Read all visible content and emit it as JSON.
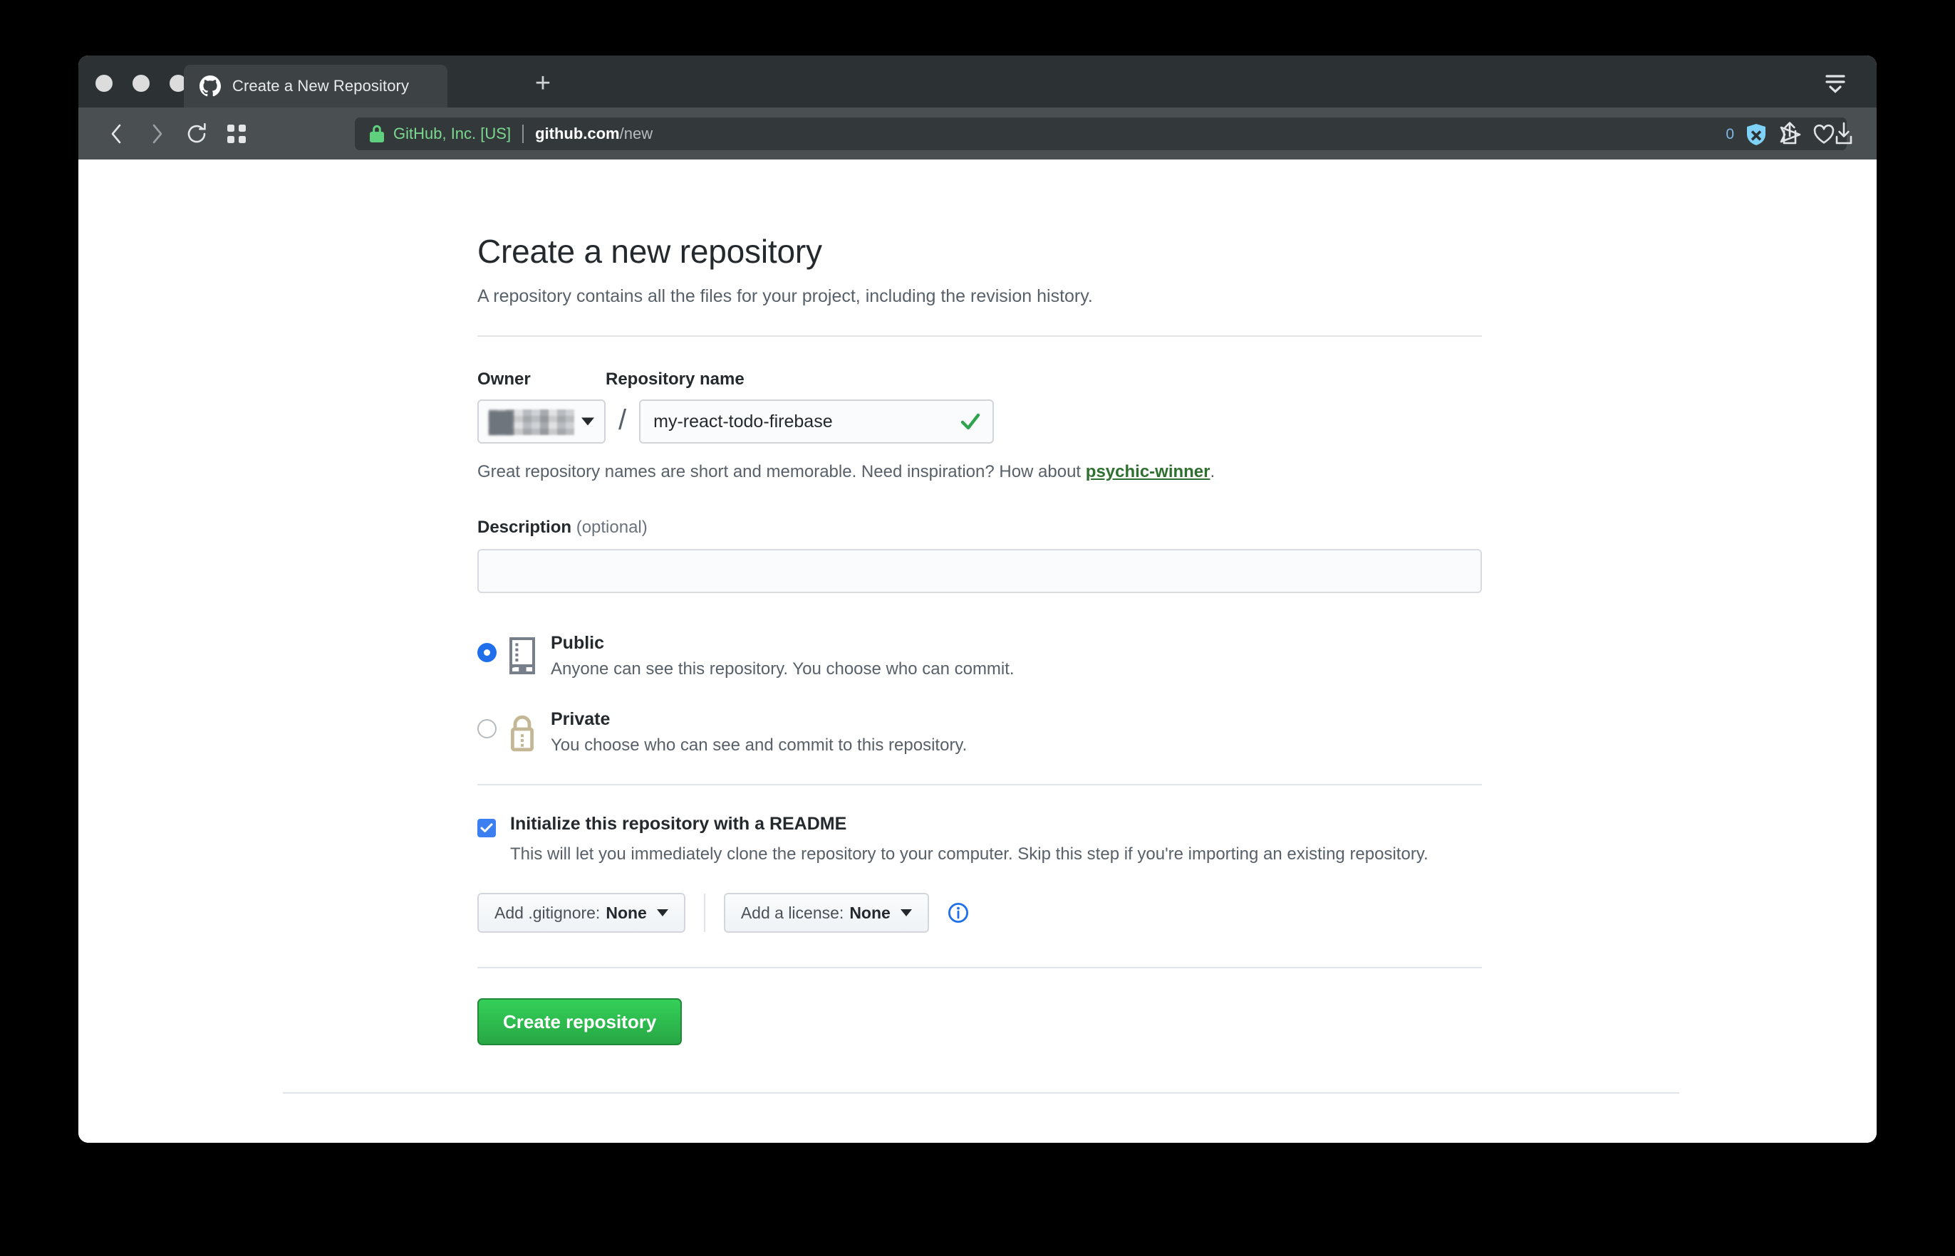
{
  "browser": {
    "tab": {
      "title": "Create a New Repository",
      "favicon": "github-icon"
    },
    "newtab_label": "+",
    "omnibox": {
      "security_label": "GitHub, Inc. [US]",
      "url_host": "github.com",
      "url_path": "/new",
      "lock_icon": "green-lock-icon"
    },
    "shields": {
      "blocked_count": "0",
      "shield_icon": "brave-shield-icon",
      "send_icon": "send-icon",
      "heart_icon": "heart-icon"
    },
    "toolbar_icons": [
      "back-icon",
      "forward-icon",
      "reload-icon",
      "apps-grid-icon",
      "share-icon",
      "download-icon",
      "tab-list-icon"
    ],
    "colors": {
      "tabstrip_bg": "#2c3134",
      "toolbar_bg": "#4a4f52",
      "omnibox_bg": "#33383b",
      "secure_green": "#7bd88f"
    }
  },
  "page": {
    "title": "Create a new repository",
    "subtitle": "A repository contains all the files for your project, including the revision history.",
    "owner": {
      "label": "Owner",
      "value_redacted": true
    },
    "repository": {
      "label": "Repository name",
      "value": "my-react-todo-firebase",
      "placeholder": "",
      "valid": true,
      "separator": "/"
    },
    "hint": {
      "prefix": "Great repository names are short and memorable. Need inspiration? How about ",
      "suggestion": "psychic-winner",
      "suffix": "."
    },
    "description": {
      "label": "Description",
      "optional_label": "(optional)",
      "value": "",
      "placeholder": ""
    },
    "visibility": {
      "selected": "public",
      "options": [
        {
          "id": "public",
          "title": "Public",
          "description": "Anyone can see this repository. You choose who can commit.",
          "icon": "repo-book-icon",
          "checked": true
        },
        {
          "id": "private",
          "title": "Private",
          "description": "You choose who can see and commit to this repository.",
          "icon": "lock-icon",
          "checked": false
        }
      ]
    },
    "readme": {
      "checked": true,
      "title": "Initialize this repository with a README",
      "description": "This will let you immediately clone the repository to your computer. Skip this step if you're importing an existing repository."
    },
    "gitignore": {
      "prefix": "Add .gitignore:",
      "value": "None"
    },
    "license": {
      "prefix": "Add a license:",
      "value": "None",
      "info_icon": "info-icon"
    },
    "submit": {
      "label": "Create repository"
    },
    "colors": {
      "accent_green": "#28a745",
      "link_green": "#2f6f2f",
      "radio_blue": "#1f6feb",
      "checkbox_blue": "#3b7ff0",
      "text": "#24292e",
      "muted_text": "#586069",
      "border": "#d1d5da"
    }
  }
}
